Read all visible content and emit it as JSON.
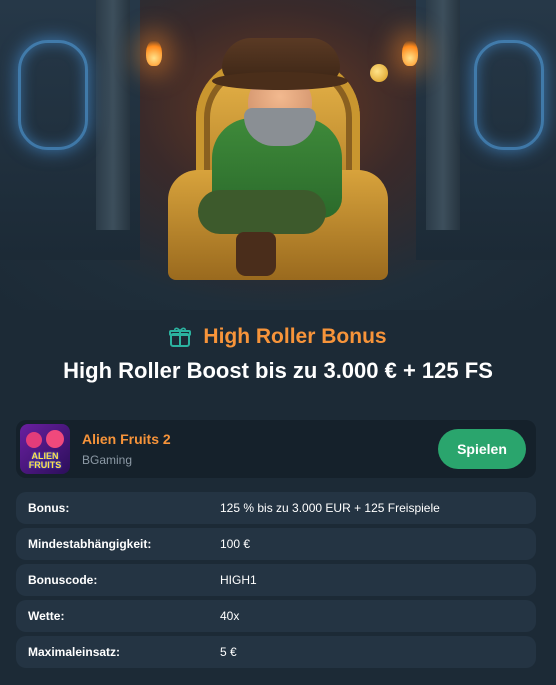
{
  "offer": {
    "type_label": "High Roller Bonus",
    "title": "High Roller Boost bis zu 3.000 € + 125 FS",
    "icon": "gift-icon"
  },
  "game": {
    "thumbnail_text": "ALIEN FRUITS",
    "name": "Alien Fruits 2",
    "provider": "BGaming",
    "play_label": "Spielen"
  },
  "details": [
    {
      "label": "Bonus:",
      "value": "125 % bis zu 3.000 EUR + 125 Freispiele"
    },
    {
      "label": "Mindestabhängigkeit:",
      "value": "100 €"
    },
    {
      "label": "Bonuscode:",
      "value": "HIGH1"
    },
    {
      "label": "Wette:",
      "value": "40x"
    },
    {
      "label": "Maximaleinsatz:",
      "value": "5 €"
    }
  ],
  "colors": {
    "accent": "#f7943a",
    "play_button": "#2aa56d",
    "background": "#1c2a36",
    "row_background": "#243443"
  }
}
